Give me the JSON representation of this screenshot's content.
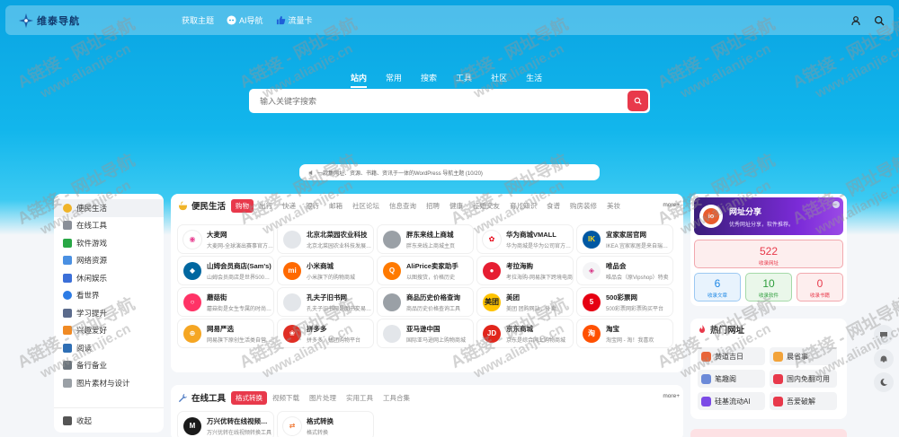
{
  "header": {
    "logo_text": "维泰导航",
    "nav": [
      {
        "label": "获取主题",
        "icon": ""
      },
      {
        "label": "AI导航",
        "icon": "ai-robot-icon"
      },
      {
        "label": "流量卡",
        "icon": "thumbs-up-icon"
      }
    ],
    "right_icons": [
      "user-icon",
      "search-icon"
    ]
  },
  "search": {
    "tabs": [
      "站内",
      "常用",
      "搜索",
      "工具",
      "社区",
      "生活"
    ],
    "active_tab": 0,
    "placeholder": "输入关键字搜索"
  },
  "notice": "一款集网址、资源、书籍、资讯于一体的WordPress 导航主题 (10/20)",
  "sidebar": {
    "items": [
      {
        "label": "便民生活",
        "color": "#f0b429"
      },
      {
        "label": "在线工具",
        "color": "#8a8f98"
      },
      {
        "label": "软件游戏",
        "color": "#28a745"
      },
      {
        "label": "网络资源",
        "color": "#4a90e2"
      },
      {
        "label": "休闲娱乐",
        "color": "#3b6fd8"
      },
      {
        "label": "看世界",
        "color": "#2c7be5"
      },
      {
        "label": "学习提升",
        "color": "#5b6b8c"
      },
      {
        "label": "兴趣爱好",
        "color": "#f08a24"
      },
      {
        "label": "阅读",
        "color": "#2f6fb5"
      },
      {
        "label": "备行备业",
        "color": "#6c757d"
      },
      {
        "label": "图片素材与设计",
        "color": "#9aa0a6"
      }
    ],
    "footer": "收起"
  },
  "life_card": {
    "title": "便民生活",
    "tabs": [
      "购物",
      "出行",
      "快递",
      "银行",
      "邮箱",
      "社区论坛",
      "信息查询",
      "招聘",
      "健康",
      "征婚交友",
      "育儿知识",
      "食谱",
      "购房装修",
      "美妆"
    ],
    "active_tab": 0,
    "more": "more+",
    "sites": [
      {
        "name": "大麦网",
        "desc": "大麦网-全球演出赛事官方购票平台",
        "color": "#ffffff",
        "glyph": "◉",
        "glyph_color": "#e84393"
      },
      {
        "name": "北京北菜园农业科技",
        "desc": "北京北菜园农业科技发展有限公司",
        "color": "#e3e6ea",
        "glyph": "",
        "glyph_color": "#888888"
      },
      {
        "name": "胖东来线上商城",
        "desc": "胖东来线上商城主页",
        "color": "#9aa0a6",
        "glyph": "",
        "glyph_color": "#ffffff"
      },
      {
        "name": "华为商城VMALL",
        "desc": "华为商城是华为公司官方线上商城",
        "color": "#ffffff",
        "glyph": "✿",
        "glyph_color": "#e60012"
      },
      {
        "name": "宜家家居官网",
        "desc": "IKEA 宜家家居是来自瑞典的家居品牌",
        "color": "#0058a3",
        "glyph": "IK",
        "glyph_color": "#ffda1a"
      },
      {
        "name": "山姆会员商店(Sam's)",
        "desc": "山姆会员商店是世界500强企业",
        "color": "#0067a0",
        "glyph": "◆",
        "glyph_color": "#ffffff"
      },
      {
        "name": "小米商城",
        "desc": "小米旗下的购物商城",
        "color": "#ff6900",
        "glyph": "mi",
        "glyph_color": "#ffffff"
      },
      {
        "name": "AliPrice卖家助手",
        "desc": "以图搜货，价格历史",
        "color": "#ff7a00",
        "glyph": "Q",
        "glyph_color": "#ffffff"
      },
      {
        "name": "考拉海购",
        "desc": "考拉海购-网易旗下跨境电商",
        "color": "#e61e32",
        "glyph": "●",
        "glyph_color": "#ffffff"
      },
      {
        "name": "唯品会",
        "desc": "唯品会（原Vipshop）特卖",
        "color": "#f4f4f6",
        "glyph": "◈",
        "glyph_color": "#d63384"
      },
      {
        "name": "蘑菇街",
        "desc": "蘑菇街是女生专属的时尚购物",
        "color": "#ff3366",
        "glyph": "○",
        "glyph_color": "#ffffff"
      },
      {
        "name": "孔夫子旧书网",
        "desc": "孔夫子旧书网是图书交易平台",
        "color": "#e3e6ea",
        "glyph": "",
        "glyph_color": "#888888"
      },
      {
        "name": "商品历史价格查询",
        "desc": "商品历史价格查询工具",
        "color": "#9aa0a6",
        "glyph": "",
        "glyph_color": "#ffffff"
      },
      {
        "name": "美团",
        "desc": "美团 团购网站，外卖",
        "color": "#ffc300",
        "glyph": "美团",
        "glyph_color": "#222222"
      },
      {
        "name": "500彩票网",
        "desc": "500彩票网彩票购买平台",
        "color": "#e60012",
        "glyph": "5",
        "glyph_color": "#ffffff"
      },
      {
        "name": "网易严选",
        "desc": "网易旗下原创生活类自营电商",
        "color": "#f5a623",
        "glyph": "⊕",
        "glyph_color": "#ffffff"
      },
      {
        "name": "拼多多",
        "desc": "拼多多，拼团购物平台",
        "color": "#e02e24",
        "glyph": "❀",
        "glyph_color": "#ffffff"
      },
      {
        "name": "亚马逊中国",
        "desc": "国际亚马逊网上购物商城",
        "color": "#e3e6ea",
        "glyph": "",
        "glyph_color": "#888888"
      },
      {
        "name": "京东商城",
        "desc": "京东是综合网上购物商城",
        "color": "#e1251b",
        "glyph": "JD",
        "glyph_color": "#ffffff"
      },
      {
        "name": "淘宝",
        "desc": "淘宝网 - 淘！我喜欢",
        "color": "#ff5000",
        "glyph": "淘",
        "glyph_color": "#ffffff"
      }
    ]
  },
  "tools_card": {
    "title": "在线工具",
    "tabs": [
      "格式转换",
      "视频下载",
      "图片处理",
      "实用工具",
      "工具合集"
    ],
    "active_tab": 0,
    "more": "more+",
    "sites": [
      {
        "name": "万兴优转在线视频转换",
        "desc": "万兴优转在线视频转换工具",
        "color": "#1b1b1b",
        "glyph": "M",
        "glyph_color": "#ffffff"
      },
      {
        "name": "格式转换",
        "desc": "格式转换",
        "color": "#ffffff",
        "glyph": "⇄",
        "glyph_color": "#f07c3a"
      }
    ]
  },
  "share": {
    "logo": "io",
    "title": "网址分享",
    "subtitle": "优秀网址分享，软件推荐。",
    "total": {
      "value": "522",
      "label": "收录网址"
    },
    "stats": [
      {
        "value": "6",
        "label": "收录文章",
        "color": "#1e88e5",
        "bg": "#e8f3fd",
        "border": "#9cc9f2"
      },
      {
        "value": "10",
        "label": "收录软件",
        "color": "#2e9d3c",
        "bg": "#eaf7ea",
        "border": "#a4d9a8"
      },
      {
        "value": "0",
        "label": "收录书籍",
        "color": "#e8394b",
        "bg": "#fdeeee",
        "border": "#f2a8ae"
      }
    ]
  },
  "hot": {
    "title": "热门网址",
    "items": [
      {
        "label": "黄道吉日",
        "color": "#e8663b"
      },
      {
        "label": "晨省事",
        "color": "#f2a33a"
      },
      {
        "label": "笔趣阁",
        "color": "#6c8ad8"
      },
      {
        "label": "国内免翻可用",
        "color": "#e8394b"
      },
      {
        "label": "硅基流动AI",
        "color": "#7b4ae6"
      },
      {
        "label": "吾爱破解",
        "color": "#e8394b"
      }
    ]
  },
  "watermark": {
    "line1": "A链接 - 网址导航",
    "line2": "www.alianjie.cn"
  }
}
